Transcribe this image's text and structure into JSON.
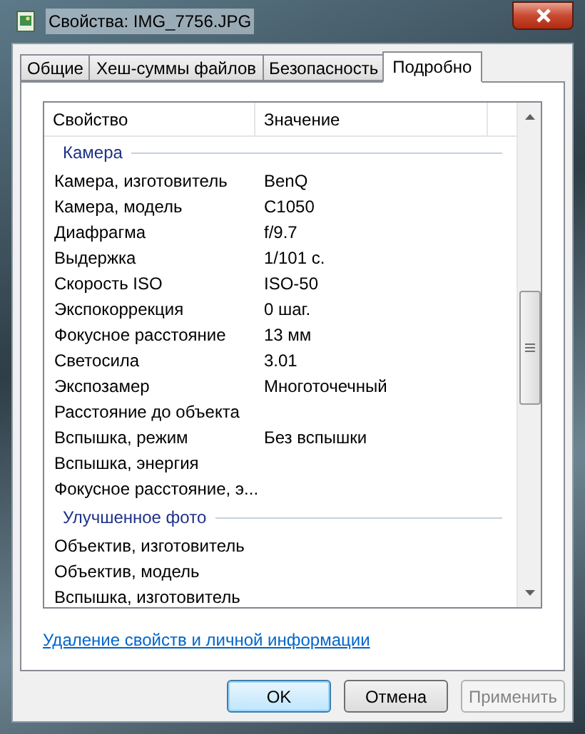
{
  "window": {
    "title": "Свойства: IMG_7756.JPG"
  },
  "tabs": [
    {
      "label": "Общие",
      "selected": false
    },
    {
      "label": "Хеш-суммы файлов",
      "selected": false
    },
    {
      "label": "Безопасность",
      "selected": false
    },
    {
      "label": "Подробно",
      "selected": true
    }
  ],
  "table": {
    "columns": [
      "Свойство",
      "Значение"
    ],
    "rows": [
      {
        "kind": "group",
        "label": "Камера"
      },
      {
        "kind": "property",
        "name": "Камера, изготовитель",
        "value": "BenQ"
      },
      {
        "kind": "property",
        "name": "Камера, модель",
        "value": "C1050"
      },
      {
        "kind": "property",
        "name": "Диафрагма",
        "value": "f/9.7"
      },
      {
        "kind": "property",
        "name": "Выдержка",
        "value": "1/101 с."
      },
      {
        "kind": "property",
        "name": "Скорость ISO",
        "value": "ISO-50"
      },
      {
        "kind": "property",
        "name": "Экспокоррекция",
        "value": "0 шаг."
      },
      {
        "kind": "property",
        "name": "Фокусное расстояние",
        "value": "13 мм"
      },
      {
        "kind": "property",
        "name": "Светосила",
        "value": "3.01"
      },
      {
        "kind": "property",
        "name": "Экспозамер",
        "value": "Многоточечный"
      },
      {
        "kind": "property",
        "name": "Расстояние до объекта"
      },
      {
        "kind": "property",
        "name": "Вспышка, режим",
        "value": "Без вспышки"
      },
      {
        "kind": "property",
        "name": "Вспышка, энергия"
      },
      {
        "kind": "property",
        "name": "Фокусное расстояние, э..."
      },
      {
        "kind": "group",
        "label": "Улучшенное фото"
      },
      {
        "kind": "property",
        "name": "Объектив, изготовитель"
      },
      {
        "kind": "property",
        "name": "Объектив, модель"
      },
      {
        "kind": "property",
        "name": "Вспышка, изготовитель"
      }
    ]
  },
  "link": "Удаление свойств и личной информации",
  "buttons": [
    {
      "label": "OK",
      "default": true,
      "disabled": false
    },
    {
      "label": "Отмена",
      "default": false,
      "disabled": false
    },
    {
      "label": "Применить",
      "default": false,
      "disabled": true
    }
  ]
}
